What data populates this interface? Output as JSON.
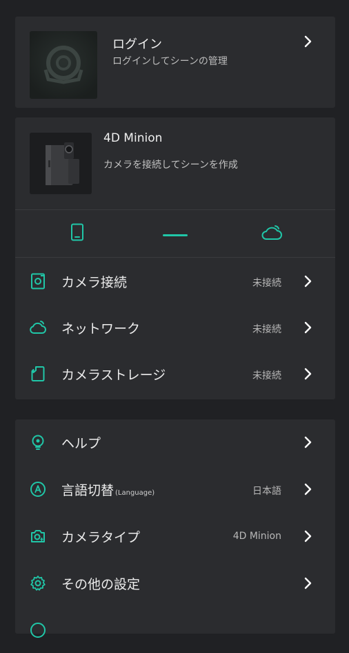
{
  "colors": {
    "accent": "#20c7a8",
    "background": "#202124",
    "card": "#2b2c2f"
  },
  "login": {
    "title": "ログイン",
    "subtitle": "ログインしてシーンの管理",
    "avatar_icon": "user-avatar-icon",
    "chevron_icon": "chevron-right-icon"
  },
  "device": {
    "name": "4D Minion",
    "subtitle": "カメラを接続してシーンを作成",
    "image": "camera-device-image",
    "tabs": [
      {
        "icon": "phone-icon",
        "selected": false
      },
      {
        "icon": "dash-icon",
        "selected": true
      },
      {
        "icon": "cloud-icon",
        "selected": false
      }
    ],
    "rows": [
      {
        "icon": "camera-connect-icon",
        "label": "カメラ接続",
        "value": "未接続"
      },
      {
        "icon": "network-cloud-icon",
        "label": "ネットワーク",
        "value": "未接続"
      },
      {
        "icon": "sd-card-icon",
        "label": "カメラストレージ",
        "value": "未接続"
      }
    ]
  },
  "settings": {
    "rows": [
      {
        "icon": "lightbulb-icon",
        "label": "ヘルプ",
        "sub": "",
        "value": ""
      },
      {
        "icon": "language-icon",
        "label": "言語切替",
        "sub": "(Language)",
        "value": "日本語"
      },
      {
        "icon": "camera-type-icon",
        "label": "カメラタイプ",
        "sub": "",
        "value": "4D Minion"
      },
      {
        "icon": "gear-icon",
        "label": "その他の設定",
        "sub": "",
        "value": ""
      }
    ]
  }
}
